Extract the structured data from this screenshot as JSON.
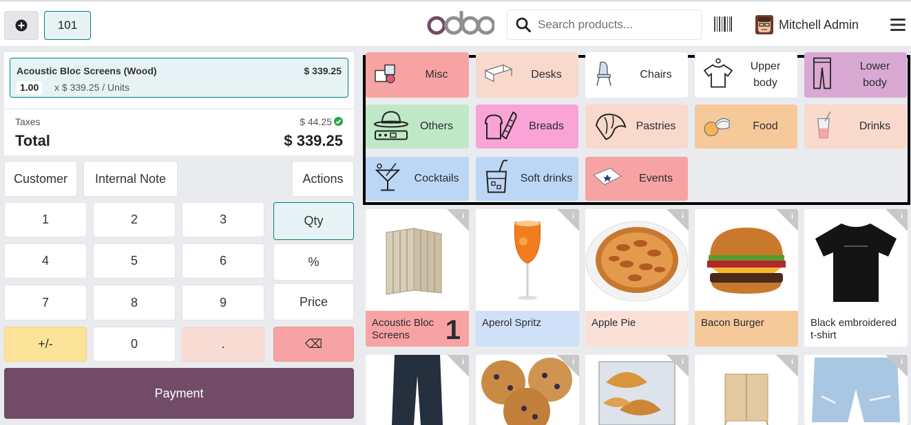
{
  "header": {
    "table_number": "101",
    "logo_text": "odoo",
    "search_placeholder": "Search products...",
    "user_name": "Mitchell Admin"
  },
  "order": {
    "line": {
      "name": "Acoustic Bloc Screens (Wood)",
      "price": "$ 339.25",
      "qty": "1.00",
      "unit_price": "x $ 339.25 / Units"
    },
    "taxes_label": "Taxes",
    "taxes_value": "$ 44.25",
    "total_label": "Total",
    "total_value": "$ 339.25"
  },
  "controls": {
    "customer": "Customer",
    "internal_note": "Internal Note",
    "actions": "Actions"
  },
  "numpad": {
    "k1": "1",
    "k2": "2",
    "k3": "3",
    "k4": "4",
    "k5": "5",
    "k6": "6",
    "k7": "7",
    "k8": "8",
    "k9": "9",
    "plusminus": "+/-",
    "k0": "0",
    "dot": ".",
    "qty": "Qty",
    "percent": "%",
    "price": "Price",
    "backspace": "⌫"
  },
  "payment_label": "Payment",
  "categories": [
    {
      "label": "Misc",
      "icon": "misc-icon",
      "color": "#f7a3a3"
    },
    {
      "label": "Desks",
      "icon": "desk-icon",
      "color": "#f8d9cc"
    },
    {
      "label": "Chairs",
      "icon": "chair-icon",
      "color": "#ffffff"
    },
    {
      "label": "Upper body",
      "icon": "tshirt-icon",
      "color": "#ffffff"
    },
    {
      "label": "Lower body",
      "icon": "pants-icon",
      "color": "#d9a9d3"
    },
    {
      "label": "Others",
      "icon": "hat-icon",
      "color": "#bfe9c6"
    },
    {
      "label": "Breads",
      "icon": "bread-icon",
      "color": "#f9a3d6"
    },
    {
      "label": "Pastries",
      "icon": "croissant-icon",
      "color": "#f8d9cc"
    },
    {
      "label": "Food",
      "icon": "food-icon",
      "color": "#f6c99a"
    },
    {
      "label": "Drinks",
      "icon": "drink-icon",
      "color": "#f8d9cc"
    },
    {
      "label": "Cocktails",
      "icon": "cocktail-icon",
      "color": "#bcd7f5"
    },
    {
      "label": "Soft drinks",
      "icon": "soft-drink-icon",
      "color": "#bcd7f5"
    },
    {
      "label": "Events",
      "icon": "ticket-icon",
      "color": "#f7a3a3"
    }
  ],
  "products": [
    {
      "name": "Acoustic Bloc Screens",
      "qty": "1",
      "color": "#f7a3a3"
    },
    {
      "name": "Aperol Spritz",
      "color": "#cfe0f8"
    },
    {
      "name": "Apple Pie",
      "color": "#f9e1d8"
    },
    {
      "name": "Bacon Burger",
      "color": "#f6c99a"
    },
    {
      "name": "Black embroidered t-shirt",
      "color": "#ffffff"
    }
  ],
  "colors": {
    "accent_teal": "#017e84",
    "brand_purple": "#714b67",
    "success_green": "#28a745"
  }
}
